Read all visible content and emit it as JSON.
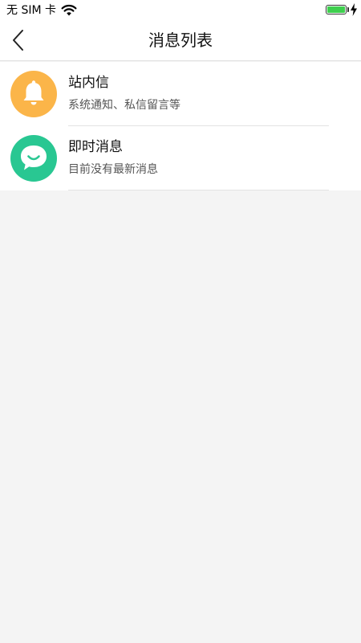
{
  "status_bar": {
    "carrier": "无 SIM 卡",
    "battery_level": 1.0,
    "charging": true,
    "battery_color": "#3ecf4e"
  },
  "nav": {
    "title": "消息列表",
    "back_icon": "chevron-left-icon"
  },
  "messages": [
    {
      "title": "站内信",
      "subtitle": "系统通知、私信留言等",
      "icon": "bell-icon",
      "color": "#fbb549"
    },
    {
      "title": "即时消息",
      "subtitle": "目前没有最新消息",
      "icon": "chat-smile-icon",
      "color": "#29c792"
    }
  ]
}
